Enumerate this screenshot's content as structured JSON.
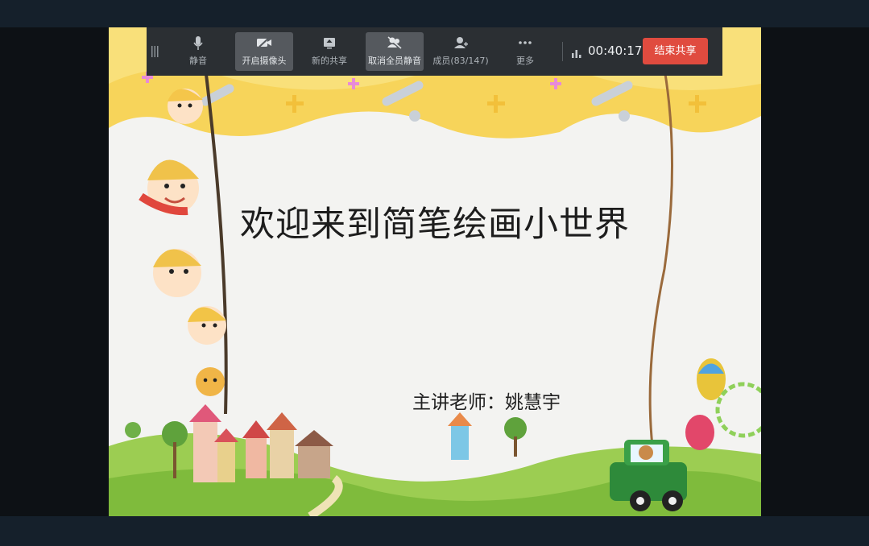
{
  "toolbar": {
    "mute_label": "静音",
    "camera_label": "开启摄像头",
    "new_share_label": "新的共享",
    "unmute_all_label": "取消全员静音",
    "members_label": "成员(83/147)",
    "more_label": "更多",
    "timer": "00:40:17",
    "end_share_label": "结束共享"
  },
  "slide": {
    "title": "欢迎来到简笔绘画小世界",
    "presenter": "主讲老师：姚慧宇"
  },
  "colors": {
    "toolbar_bg": "#2b2f33",
    "active_button_bg": "#55595e",
    "end_button": "#e04b3f",
    "frame_bg": "#15202b"
  },
  "icons": [
    "drag-handle-icon",
    "microphone-icon",
    "camera-off-icon",
    "screen-share-icon",
    "mute-all-icon",
    "members-icon",
    "more-icon",
    "signal-icon"
  ]
}
